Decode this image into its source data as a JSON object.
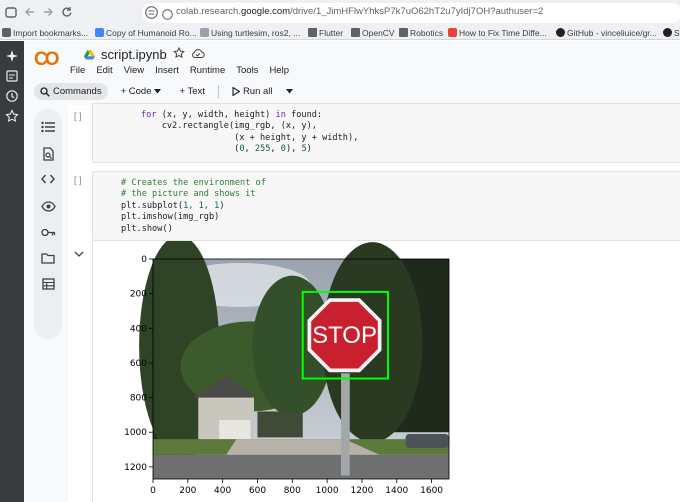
{
  "browser": {
    "url_prefix": "colab.research.",
    "url_domain": "google.com",
    "url_path": "/drive/1_JimHFlwYhksP7k7uO62hT2u7yIdj7OH?authuser=2",
    "bookmarks": [
      {
        "label": "Import bookmarks...",
        "color": "#5f6368"
      },
      {
        "label": "Copy of Humanoid Ro...",
        "color": "#4285f4"
      },
      {
        "label": "Using turtlesim, ros2, ...",
        "color": "#5f6368"
      },
      {
        "label": "Flutter",
        "color": "#f4b400"
      },
      {
        "label": "OpenCV",
        "color": "#f4b400"
      },
      {
        "label": "Robotics",
        "color": "#f4b400"
      },
      {
        "label": "How to Fix Time Diffe...",
        "color": "#ea4335"
      },
      {
        "label": "GitHub - vinceliuice/gr...",
        "color": "#202124"
      },
      {
        "label": "Sk",
        "color": "#202124"
      }
    ]
  },
  "colab": {
    "logo": "CO",
    "notebook_title": "script.ipynb",
    "menu": [
      "File",
      "Edit",
      "View",
      "Insert",
      "Runtime",
      "Tools",
      "Help"
    ],
    "toolbar": {
      "commands": "Commands",
      "code": "+ Code",
      "text": "+ Text",
      "run_all": "Run all"
    },
    "cell1": {
      "gutter": "[ ]",
      "line1": {
        "kw1": "for",
        "mid1": " (x, y, width, height) ",
        "kw2": "in",
        "end": " found:"
      },
      "line2": "    cv2.rectangle(img_rgb, (x, y),",
      "line3": "                  (x + height, y + width),",
      "line4_a": "                  (",
      "line4_n1": "0",
      "line4_n2": "255",
      "line4_n3": "0",
      "line4_n4": "5",
      "line4_b": "), "
    },
    "cell2": {
      "gutter": "[ ]",
      "comment1": "# Creates the environment of",
      "comment2": "# the picture and shows it",
      "line3_fn": "plt.subplot(",
      "line3_args": "1, 1, 1",
      "line3_end": ")",
      "line4": "plt.imshow(img_rgb)",
      "line5": "plt.show()"
    }
  },
  "chart_data": {
    "type": "image",
    "xlim": [
      0,
      1700
    ],
    "ylim": [
      1270,
      0
    ],
    "x_ticks": [
      "0",
      "200",
      "400",
      "600",
      "800",
      "1000",
      "1200",
      "1400",
      "1600"
    ],
    "y_ticks": [
      "0",
      "200",
      "400",
      "600",
      "800",
      "1000",
      "1200"
    ],
    "x_tick_values": [
      0,
      200,
      400,
      600,
      800,
      1000,
      1200,
      1400,
      1600
    ],
    "y_tick_values": [
      0,
      200,
      400,
      600,
      800,
      1000,
      1200
    ],
    "image_width": 1700,
    "image_height": 1270,
    "detection_box": {
      "x1": 860,
      "y1": 190,
      "x2": 1350,
      "y2": 690,
      "color": "#00ff00"
    },
    "sign_text": "STOP",
    "grid": false
  }
}
